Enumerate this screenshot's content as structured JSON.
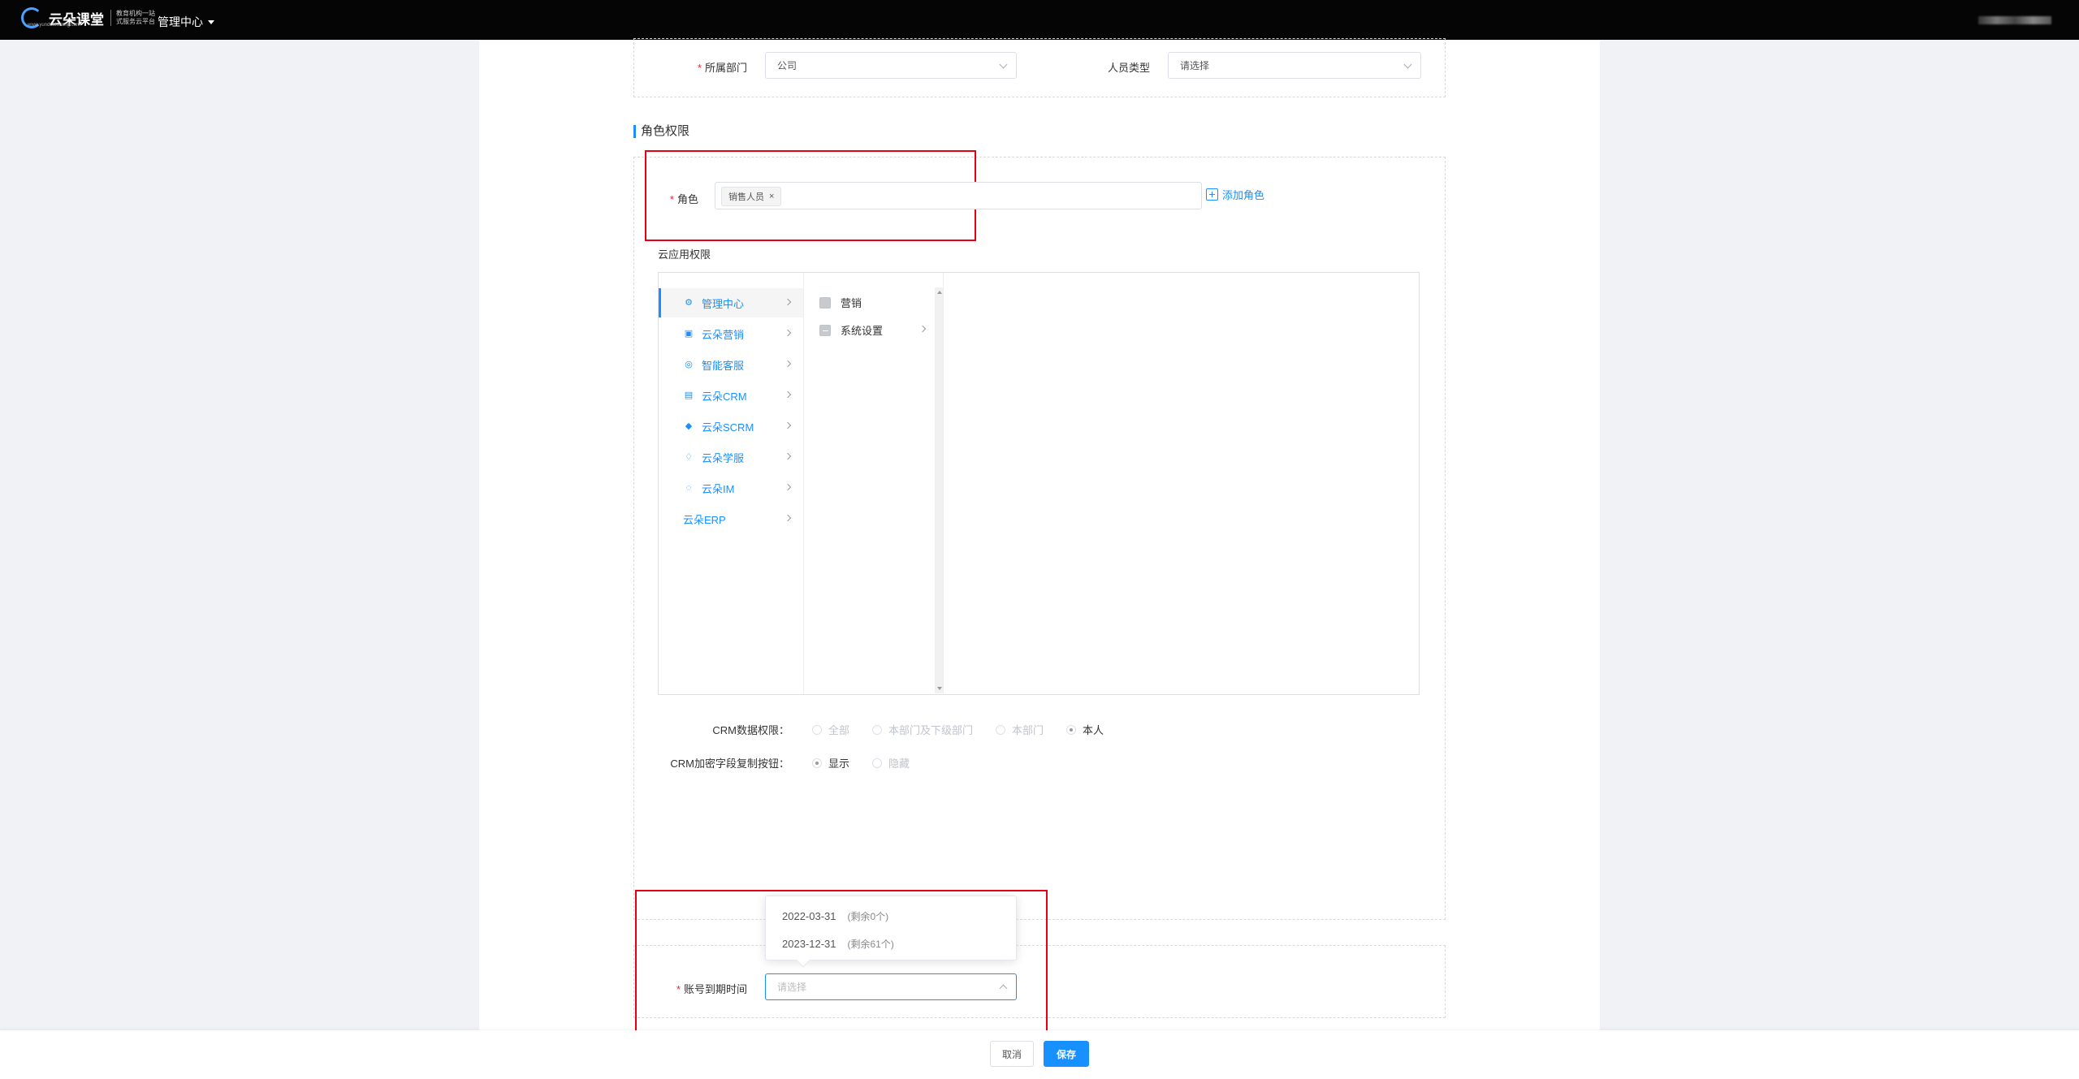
{
  "header": {
    "logo_text": "云朵课堂",
    "logo_sub1": "教育机构一站",
    "logo_sub2": "式服务云平台",
    "logo_url": "www.yunduoketang.com",
    "nav_title": "管理中心"
  },
  "form": {
    "department_label": "所属部门",
    "department_value": "公司",
    "person_type_label": "人员类型",
    "person_type_placeholder": "请选择",
    "role_section_title": "角色权限",
    "role_label": "角色",
    "role_tag": "销售人员",
    "add_role_label": "添加角色",
    "cloud_perm_title": "云应用权限"
  },
  "menu": [
    {
      "label": "管理中心",
      "icon": "gear-icon",
      "glyph": "⚙",
      "active": true
    },
    {
      "label": "云朵营销",
      "icon": "marketing-icon",
      "glyph": "▣"
    },
    {
      "label": "智能客服",
      "icon": "chat-icon",
      "glyph": "◎"
    },
    {
      "label": "云朵CRM",
      "icon": "crm-icon",
      "glyph": "▤"
    },
    {
      "label": "云朵SCRM",
      "icon": "scrm-icon",
      "glyph": "◆"
    },
    {
      "label": "云朵学服",
      "icon": "student-icon",
      "glyph": "♢"
    },
    {
      "label": "云朵IM",
      "icon": "im-icon",
      "glyph": "◌"
    },
    {
      "label": "云朵ERP",
      "icon": "",
      "glyph": ""
    }
  ],
  "submenu": [
    {
      "label": "营销"
    },
    {
      "label": "系统设置"
    }
  ],
  "crm": {
    "data_perm_label": "CRM数据权限：",
    "data_perm_options": [
      "全部",
      "本部门及下级部门",
      "本部门",
      "本人"
    ],
    "copy_btn_label": "CRM加密字段复制按钮：",
    "copy_btn_options": [
      "显示",
      "隐藏"
    ]
  },
  "expiry": {
    "label": "账号到期时间",
    "placeholder": "请选择",
    "options": [
      {
        "date": "2022-03-31",
        "remaining": "(剩余0个)"
      },
      {
        "date": "2023-12-31",
        "remaining": "(剩余61个)"
      }
    ]
  },
  "footer": {
    "cancel_label": "取消",
    "save_label": "保存"
  },
  "colors": {
    "accent": "#1890ff",
    "highlight_box": "#e60012",
    "topbar": "#050505"
  }
}
